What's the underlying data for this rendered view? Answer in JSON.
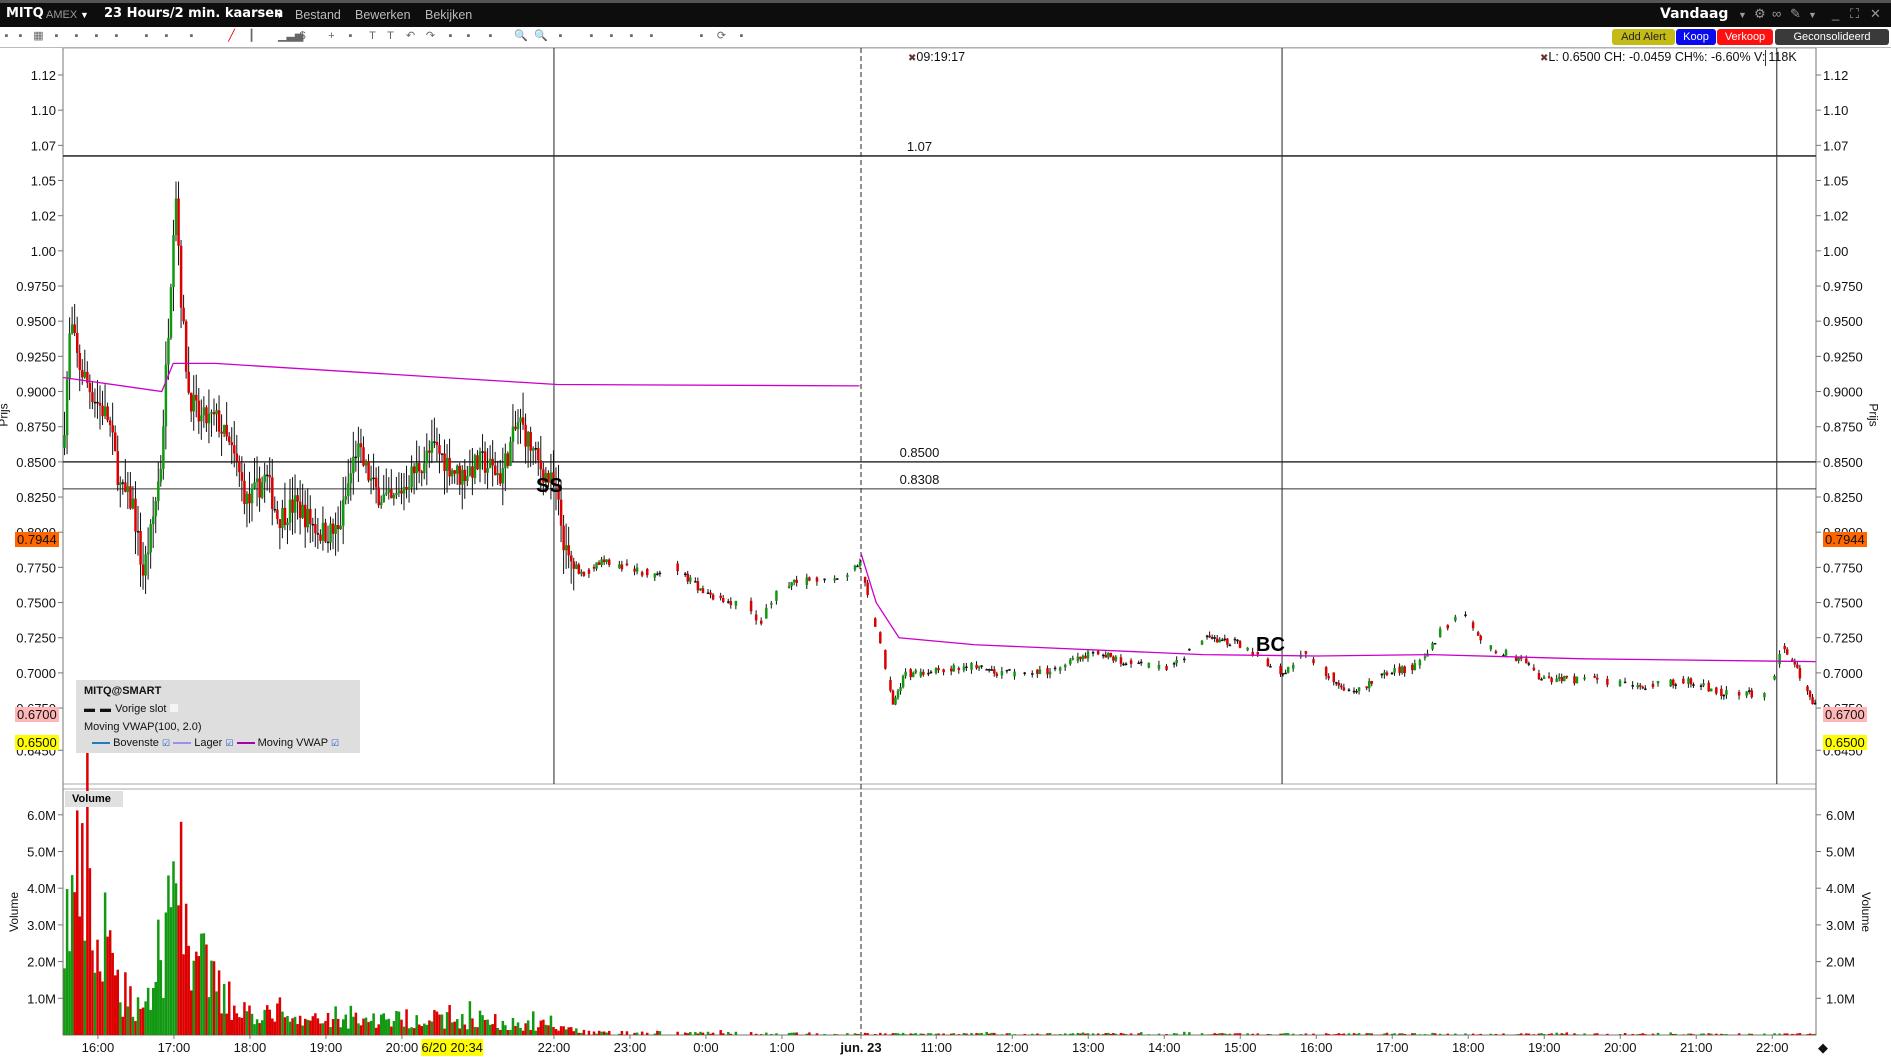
{
  "titlebar": {
    "symbol": "MITQ",
    "exchange": "AMEX",
    "period": "23 Hours/2 min. kaarsen",
    "menus": [
      "Bestand",
      "Bewerken",
      "Bekijken"
    ],
    "range": "Vandaag"
  },
  "toolbar": {
    "add_alert": "Add Alert",
    "buy": "Koop",
    "sell": "Verkoop",
    "consolidated": "Geconsolideerd"
  },
  "info": {
    "crosshair_time": "09:19:17",
    "summary": "L: 0.6500 CH: -0.0459 CH%: -6.60% V:",
    "volume": "118K"
  },
  "legend": {
    "title": "MITQ@SMART",
    "prev_close": "Vorige slot",
    "indicator": "Moving VWAP(100, 2.0)",
    "upper": "Bovenste",
    "lower": "Lager",
    "vwap": "Moving VWAP"
  },
  "colors": {
    "up": "#119911",
    "down": "#dd0000",
    "vwap": "#cc00cc",
    "upper": "#1a7ec0",
    "lower": "#a38cf0",
    "last_tag": "#ff6600",
    "low_tag": "#ffff00",
    "prev_tag": "#ffb6b6"
  },
  "markers": {
    "ss": "SS",
    "bc": "BC"
  },
  "chart_data": {
    "type": "candlestick",
    "ylabel": "Prijs",
    "vol_label": "Volume",
    "vol_axis_label": "Volume",
    "ylim": [
      0.6375,
      1.135
    ],
    "yticks": [
      "1.12",
      "1.10",
      "1.07",
      "1.05",
      "1.02",
      "1.00",
      "0.9750",
      "0.9500",
      "0.9250",
      "0.9000",
      "0.8750",
      "0.8500",
      "0.8250",
      "0.8000",
      "0.7750",
      "0.7500",
      "0.7250",
      "0.7000",
      "0.6750",
      "0.6450"
    ],
    "ytick_values": [
      1.125,
      1.1,
      1.075,
      1.05,
      1.025,
      1.0,
      0.975,
      0.95,
      0.925,
      0.9,
      0.875,
      0.85,
      0.825,
      0.8,
      0.775,
      0.75,
      0.725,
      0.7,
      0.675,
      0.645
    ],
    "hlines": [
      {
        "value": 1.0675,
        "label": "1.07"
      },
      {
        "value": 0.85,
        "label": "0.8500"
      },
      {
        "value": 0.8308,
        "label": "0.8308"
      }
    ],
    "tags": {
      "last": "0.7944",
      "last_value": 0.7944,
      "prev": "0.6700",
      "prev_value": 0.67,
      "low": "0.6500",
      "low_value": 0.65
    },
    "vol_ticks": [
      "6.0M",
      "5.0M",
      "4.0M",
      "3.0M",
      "2.0M",
      "1.0M"
    ],
    "vol_tick_values": [
      6,
      5,
      4,
      3,
      2,
      1
    ],
    "xticks": [
      {
        "t": 0.46,
        "label": "16:00"
      },
      {
        "t": 1.46,
        "label": "17:00"
      },
      {
        "t": 2.46,
        "label": "18:00"
      },
      {
        "t": 3.46,
        "label": "19:00"
      },
      {
        "t": 4.46,
        "label": "20:00"
      },
      {
        "t": 6.46,
        "label": "22:00"
      },
      {
        "t": 7.46,
        "label": "23:00"
      },
      {
        "t": 8.46,
        "label": "0:00"
      },
      {
        "t": 9.46,
        "label": "1:00"
      },
      {
        "t": 10.5,
        "label": "jun. 23",
        "bold": true
      },
      {
        "t": 11.49,
        "label": "11:00"
      },
      {
        "t": 12.49,
        "label": "12:00"
      },
      {
        "t": 13.49,
        "label": "13:00"
      },
      {
        "t": 14.49,
        "label": "14:00"
      },
      {
        "t": 15.49,
        "label": "15:00"
      },
      {
        "t": 16.49,
        "label": "16:00"
      },
      {
        "t": 17.49,
        "label": "17:00"
      },
      {
        "t": 18.49,
        "label": "18:00"
      },
      {
        "t": 19.49,
        "label": "19:00"
      },
      {
        "t": 20.49,
        "label": "20:00"
      },
      {
        "t": 21.49,
        "label": "21:00"
      },
      {
        "t": 22.49,
        "label": "22:00"
      }
    ],
    "x_highlight": {
      "t": 5.2,
      "label": "6/20 20:34"
    },
    "vlines": [
      6.46,
      10.5,
      16.04,
      22.55
    ],
    "price_path": [
      [
        0,
        0.86
      ],
      [
        0.1,
        0.95
      ],
      [
        0.2,
        0.92
      ],
      [
        0.37,
        0.9
      ],
      [
        0.6,
        0.88
      ],
      [
        0.76,
        0.83
      ],
      [
        0.92,
        0.82
      ],
      [
        1.05,
        0.77
      ],
      [
        1.16,
        0.8
      ],
      [
        1.29,
        0.85
      ],
      [
        1.4,
        0.96
      ],
      [
        1.48,
        1.05
      ],
      [
        1.56,
        0.96
      ],
      [
        1.65,
        0.9
      ],
      [
        1.79,
        0.88
      ],
      [
        2.03,
        0.88
      ],
      [
        2.27,
        0.85
      ],
      [
        2.43,
        0.82
      ],
      [
        2.67,
        0.84
      ],
      [
        2.83,
        0.81
      ],
      [
        3.06,
        0.82
      ],
      [
        3.38,
        0.8
      ],
      [
        3.62,
        0.8
      ],
      [
        3.86,
        0.86
      ],
      [
        4.1,
        0.83
      ],
      [
        4.33,
        0.82
      ],
      [
        4.57,
        0.84
      ],
      [
        4.89,
        0.86
      ],
      [
        5.21,
        0.84
      ],
      [
        5.52,
        0.85
      ],
      [
        5.76,
        0.84
      ],
      [
        6.0,
        0.88
      ],
      [
        6.24,
        0.85
      ],
      [
        6.48,
        0.83
      ],
      [
        6.63,
        0.78
      ],
      [
        6.87,
        0.77
      ],
      [
        7.11,
        0.78
      ],
      [
        7.43,
        0.775
      ],
      [
        7.75,
        0.77
      ],
      [
        8.06,
        0.775
      ],
      [
        8.38,
        0.76
      ],
      [
        8.7,
        0.75
      ],
      [
        9.02,
        0.75
      ],
      [
        9.17,
        0.735
      ],
      [
        9.41,
        0.76
      ],
      [
        9.65,
        0.765
      ],
      [
        9.97,
        0.765
      ],
      [
        10.29,
        0.77
      ],
      [
        10.48,
        0.78
      ],
      [
        10.6,
        0.75
      ],
      [
        10.76,
        0.72
      ],
      [
        10.92,
        0.68
      ],
      [
        11.08,
        0.7
      ],
      [
        11.4,
        0.7
      ],
      [
        11.87,
        0.705
      ],
      [
        12.35,
        0.7
      ],
      [
        12.83,
        0.7
      ],
      [
        13.14,
        0.705
      ],
      [
        13.62,
        0.715
      ],
      [
        14.1,
        0.705
      ],
      [
        14.57,
        0.705
      ],
      [
        15.05,
        0.725
      ],
      [
        15.52,
        0.72
      ],
      [
        16.05,
        0.7
      ],
      [
        16.32,
        0.715
      ],
      [
        16.63,
        0.7
      ],
      [
        16.95,
        0.685
      ],
      [
        17.43,
        0.7
      ],
      [
        17.83,
        0.705
      ],
      [
        18.14,
        0.73
      ],
      [
        18.41,
        0.745
      ],
      [
        18.7,
        0.72
      ],
      [
        19.17,
        0.71
      ],
      [
        19.49,
        0.695
      ],
      [
        20.13,
        0.695
      ],
      [
        20.76,
        0.69
      ],
      [
        21.4,
        0.695
      ],
      [
        21.87,
        0.685
      ],
      [
        22.43,
        0.685
      ],
      [
        22.63,
        0.72
      ],
      [
        22.83,
        0.7
      ],
      [
        23.06,
        0.675
      ]
    ],
    "vwap_path": [
      [
        [
          0,
          0.91
        ],
        [
          1.3,
          0.9
        ],
        [
          1.45,
          0.92
        ],
        [
          2,
          0.92
        ],
        [
          5,
          0.91
        ],
        [
          6.5,
          0.905
        ],
        [
          10.48,
          0.904
        ]
      ],
      [
        [
          10.5,
          0.785
        ],
        [
          10.7,
          0.75
        ],
        [
          11,
          0.725
        ],
        [
          12,
          0.72
        ],
        [
          15,
          0.713
        ],
        [
          16.5,
          0.712
        ],
        [
          18,
          0.713
        ],
        [
          20,
          0.71
        ],
        [
          23.06,
          0.708
        ]
      ]
    ],
    "volume_profile_millions": [
      [
        0,
        3.5
      ],
      [
        0.2,
        5.6
      ],
      [
        0.5,
        2.5
      ],
      [
        1.0,
        1.0
      ],
      [
        1.3,
        2.2
      ],
      [
        1.45,
        6.3
      ],
      [
        1.7,
        3.0
      ],
      [
        2.2,
        1.0
      ],
      [
        3,
        0.5
      ],
      [
        4.8,
        0.6
      ],
      [
        6.5,
        0.3
      ],
      [
        7,
        0.1
      ],
      [
        10.5,
        0.05
      ],
      [
        23,
        0.04
      ]
    ]
  }
}
